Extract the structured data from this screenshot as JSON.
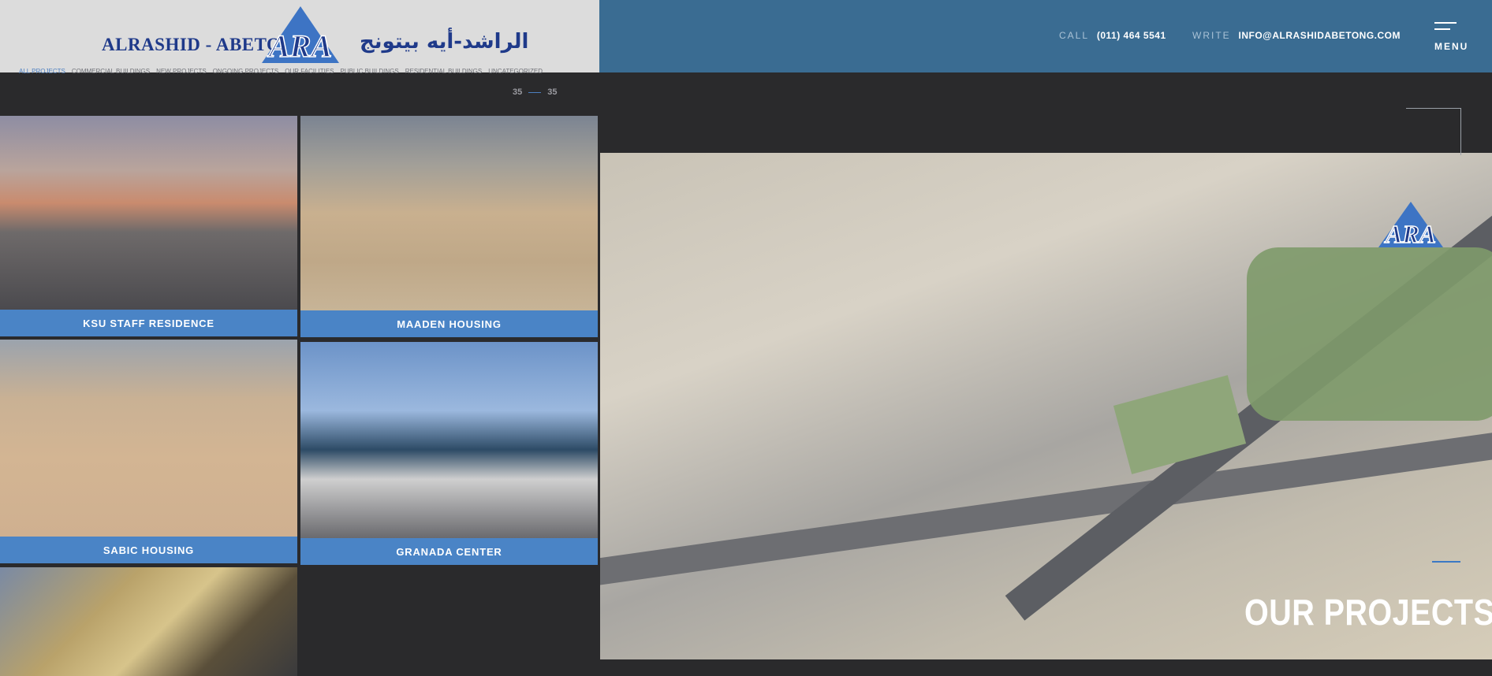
{
  "logo": {
    "en_part1": "ALRASHID",
    "en_sep": "-",
    "en_part2": "ABETONG",
    "mark_text": "ARA",
    "ar": "الراشد-أيه بيتونج"
  },
  "contact": {
    "call_label": "CALL",
    "call_value": "(011) 464 5541",
    "write_label": "WRITE",
    "write_value": "INFO@ALRASHIDABETONG.COM"
  },
  "menu": {
    "label": "MENU"
  },
  "filters": [
    "ALL PROJECTS",
    "COMMERCIAL BUILDINGS",
    "NEW PROJECTS",
    "ONGOING PROJECTS",
    "OUR FACILITIES",
    "PUBLIC BUILDINGS",
    "RESIDENTIAL BUILDINGS",
    "UNCATEGORIZED"
  ],
  "counter": {
    "current": "35",
    "total": "35"
  },
  "projects": [
    {
      "title": "KSU STAFF RESIDENCE"
    },
    {
      "title": "MAADEN HOUSING"
    },
    {
      "title": "SABIC HOUSING"
    },
    {
      "title": "GRANADA CENTER"
    },
    {
      "title": ""
    }
  ],
  "hero": {
    "title": "OUR PROJECTS",
    "logo_text": "ARA"
  },
  "colors": {
    "topbar": "#3a6c92",
    "caption": "#4a84c6",
    "background": "#2a2a2c",
    "logo_blue": "#1f3a8a"
  }
}
